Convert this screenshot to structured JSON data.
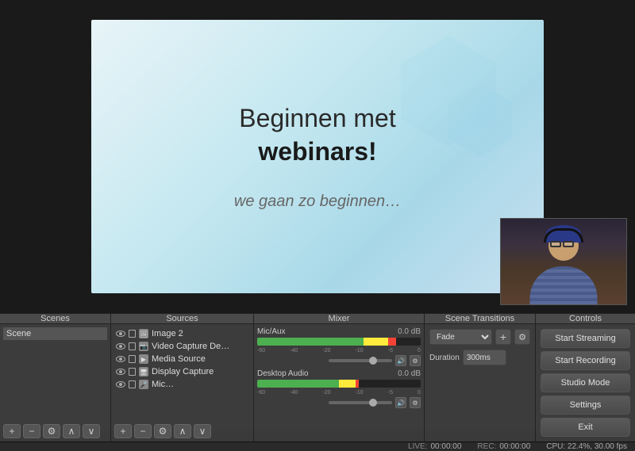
{
  "preview": {
    "slide": {
      "title_line1": "Beginnen met",
      "title_line2": "webinars!",
      "subtitle": "we gaan zo beginnen…"
    }
  },
  "sections": {
    "scenes": "Scenes",
    "sources": "Sources",
    "mixer": "Mixer",
    "transitions": "Scene Transitions",
    "controls": "Controls"
  },
  "scenes": {
    "items": [
      "Scene"
    ],
    "toolbar": {
      "add": "+",
      "remove": "−",
      "settings": "⚙",
      "up": "∧",
      "down": "∨"
    }
  },
  "sources": {
    "items": [
      {
        "name": "Image 2"
      },
      {
        "name": "Video Capture De…"
      },
      {
        "name": "Media Source"
      },
      {
        "name": "Display Capture"
      },
      {
        "name": "Mic…"
      }
    ],
    "toolbar": {
      "add": "+",
      "remove": "−",
      "settings": "⚙",
      "up": "∧",
      "down": "∨"
    }
  },
  "mixer": {
    "channels": [
      {
        "name": "Mic/Aux",
        "db": "0.0 dB",
        "level_green": 75,
        "level_yellow": 15,
        "level_red": 5
      },
      {
        "name": "Desktop Audio",
        "db": "0.0 dB",
        "level_green": 60,
        "level_yellow": 10,
        "level_red": 3
      }
    ],
    "labels": [
      "-60",
      "-40",
      "-20",
      "-10",
      "-5",
      "0"
    ]
  },
  "transitions": {
    "type": "Fade",
    "duration_label": "Duration",
    "duration_value": "300ms"
  },
  "controls": {
    "start_streaming": "Start Streaming",
    "start_recording": "Start Recording",
    "studio_mode": "Studio Mode",
    "settings": "Settings",
    "exit": "Exit"
  },
  "statusbar": {
    "live_label": "LIVE:",
    "live_time": "00:00:00",
    "rec_label": "REC:",
    "rec_time": "00:00:00",
    "cpu_label": "CPU: 22.4%, 30.00 fps"
  }
}
